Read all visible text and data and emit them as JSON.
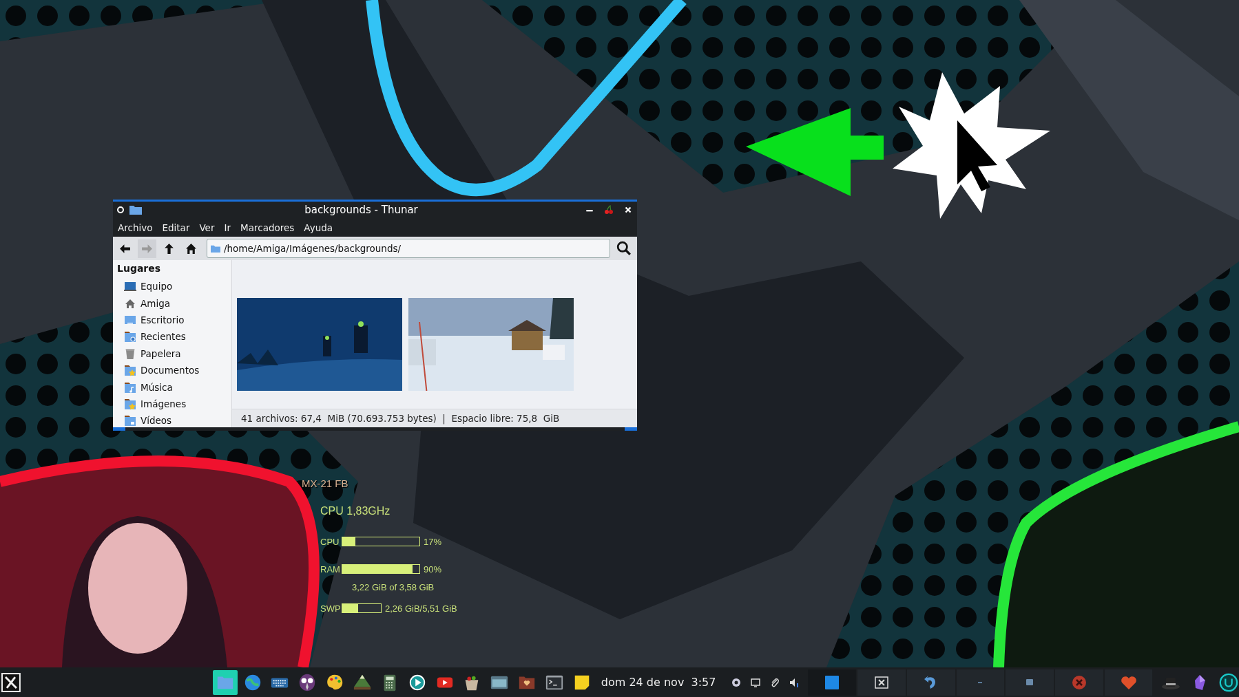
{
  "window": {
    "title": "backgrounds - Thunar",
    "menu": [
      "Archivo",
      "Editar",
      "Ver",
      "Ir",
      "Marcadores",
      "Ayuda"
    ],
    "toolbar": [
      {
        "kind": "back",
        "disabled": false
      },
      {
        "kind": "forward",
        "disabled": true
      },
      {
        "kind": "up",
        "disabled": false
      },
      {
        "kind": "home",
        "disabled": false
      }
    ],
    "location": "/home/Amiga/Imágenes/backgrounds/",
    "sidebar": {
      "heading": "Lugares",
      "items": [
        {
          "label": "Equipo",
          "kind": "computer"
        },
        {
          "label": "Amiga",
          "kind": "home"
        },
        {
          "label": "Escritorio",
          "kind": "desktop"
        },
        {
          "label": "Recientes",
          "kind": "recent"
        },
        {
          "label": "Papelera",
          "kind": "trash"
        },
        {
          "label": "Documentos",
          "kind": "starred"
        },
        {
          "label": "Música",
          "kind": "music"
        },
        {
          "label": "Imágenes",
          "kind": "starred"
        },
        {
          "label": "Vídeos",
          "kind": "video"
        }
      ]
    },
    "files": [
      {
        "kind": "picture"
      },
      {
        "kind": "picture"
      }
    ],
    "status_bar": "41 archivos: 67,4  MiB (70.693.753 bytes)  |  Espacio libre: 75,8  GiB"
  },
  "conky": {
    "host": "MX-21 FB",
    "cpu_freq": "CPU 1,83GHz",
    "meters": [
      {
        "label": "CPU",
        "level": 0.17,
        "reading": "17%"
      },
      {
        "label": "RAM",
        "level": 0.91,
        "reading": "90%",
        "detail": "3,22 GiB of 3,58 GiB"
      },
      {
        "label": "SWP",
        "level": 0.41,
        "reading": "2,26 GiB/5,51 GiB"
      }
    ]
  },
  "taskbar": {
    "launchers": [
      {
        "kind": "files",
        "selected": true
      },
      {
        "kind": "globe",
        "selected": false
      },
      {
        "kind": "keyboard",
        "selected": false
      },
      {
        "kind": "owl",
        "selected": false
      },
      {
        "kind": "palette",
        "selected": false
      },
      {
        "kind": "mountain",
        "selected": false
      },
      {
        "kind": "calculator",
        "selected": false
      },
      {
        "kind": "play",
        "selected": false
      },
      {
        "kind": "video",
        "selected": false
      },
      {
        "kind": "basket",
        "selected": false
      },
      {
        "kind": "screen",
        "selected": false
      },
      {
        "kind": "folder-heart",
        "selected": false
      },
      {
        "kind": "terminal",
        "selected": false
      },
      {
        "kind": "note",
        "selected": false
      }
    ],
    "clock": "dom 24 de nov  3:57",
    "tasks": [
      {
        "kind": "square",
        "selected": true
      },
      {
        "kind": "close",
        "selected": false
      },
      {
        "kind": "arrow",
        "selected": false
      },
      {
        "kind": "minimize",
        "selected": false
      },
      {
        "kind": "small-square",
        "selected": false
      },
      {
        "kind": "cancel",
        "selected": false
      },
      {
        "kind": "heart",
        "selected": false
      }
    ]
  }
}
